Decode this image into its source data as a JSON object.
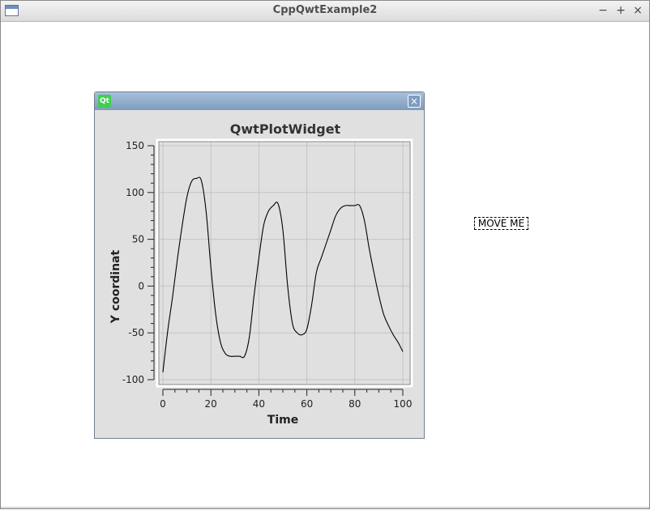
{
  "window": {
    "title": "CppQwtExample2",
    "minimize": "−",
    "maximize": "+",
    "close": "×"
  },
  "subwindow": {
    "logo": "Qt",
    "close": "×"
  },
  "move_label": "MOVE ME",
  "chart_data": {
    "type": "line",
    "title": "QwtPlotWidget",
    "xlabel": "Time",
    "ylabel": "Y coordinat",
    "xlim": [
      0,
      100
    ],
    "ylim": [
      -100,
      150
    ],
    "xticks": [
      0,
      20,
      40,
      60,
      80,
      100
    ],
    "yticks": [
      -100,
      -50,
      0,
      50,
      100,
      150
    ],
    "grid": true,
    "line_color": "#000000",
    "series": [
      {
        "x": [
          0,
          2,
          4,
          6,
          8,
          10,
          12,
          14,
          16,
          18,
          20,
          22,
          24,
          26,
          28,
          30,
          32,
          34,
          36,
          38,
          40,
          42,
          44,
          46,
          48,
          50,
          52,
          54,
          56,
          58,
          60,
          62,
          64,
          66,
          68,
          70,
          72,
          74,
          76,
          78,
          80,
          82,
          84,
          86,
          88,
          90,
          92,
          94,
          96,
          98,
          100
        ],
        "y": [
          -92,
          -48,
          -12,
          28,
          64,
          95,
          112,
          115,
          113,
          80,
          20,
          -30,
          -60,
          -72,
          -75,
          -75,
          -75,
          -75,
          -55,
          -10,
          30,
          65,
          80,
          86,
          88,
          60,
          0,
          -40,
          -50,
          -52,
          -46,
          -20,
          15,
          30,
          45,
          60,
          75,
          83,
          86,
          86,
          86,
          86,
          70,
          40,
          14,
          -10,
          -30,
          -42,
          -52,
          -60,
          -70
        ]
      }
    ]
  }
}
